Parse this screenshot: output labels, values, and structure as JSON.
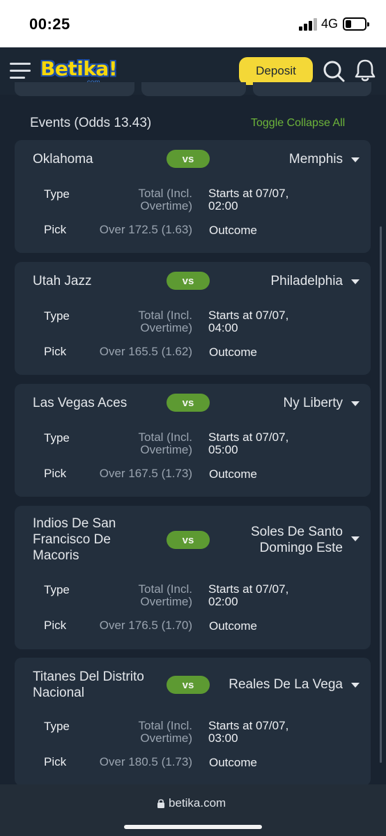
{
  "status_bar": {
    "time": "00:25",
    "network": "4G",
    "battery_percent": 25
  },
  "header": {
    "logo_text": "Betika!",
    "logo_sub": ".com",
    "deposit_label": "Deposit",
    "icons": [
      "menu-icon",
      "search-icon",
      "bell-icon"
    ]
  },
  "events": {
    "title": "Events (Odds 13.43)",
    "toggle_label": "Toggle Collapse All",
    "vs_label": "vs",
    "type_label": "Type",
    "pick_label": "Pick",
    "outcome_label": "Outcome",
    "items": [
      {
        "home": "Oklahoma",
        "away": "Memphis",
        "type_line1": "Total (Incl.",
        "type_line2": "Overtime)",
        "starts_line1": "Starts at 07/07,",
        "starts_line2": "02:00",
        "pick": "Over 172.5 (1.63)"
      },
      {
        "home": "Utah Jazz",
        "away": "Philadelphia",
        "type_line1": "Total (Incl.",
        "type_line2": "Overtime)",
        "starts_line1": "Starts at 07/07,",
        "starts_line2": "04:00",
        "pick": "Over 165.5 (1.62)"
      },
      {
        "home": "Las Vegas Aces",
        "away": "Ny Liberty",
        "type_line1": "Total (Incl.",
        "type_line2": "Overtime)",
        "starts_line1": "Starts at 07/07,",
        "starts_line2": "05:00",
        "pick": "Over 167.5 (1.73)"
      },
      {
        "home_line1": "Indios De San",
        "home_line2": "Francisco De",
        "home_line3": "Macoris",
        "away_line1": "Soles De Santo",
        "away_line2": "Domingo Este",
        "type_line1": "Total (Incl.",
        "type_line2": "Overtime)",
        "starts_line1": "Starts at 07/07,",
        "starts_line2": "02:00",
        "pick": "Over 176.5 (1.70)"
      },
      {
        "home_line1": "Titanes Del Distrito",
        "home_line2": "Nacional",
        "away": "Reales De La Vega",
        "type_line1": "Total (Incl.",
        "type_line2": "Overtime)",
        "starts_line1": "Starts at 07/07,",
        "starts_line2": "03:00",
        "pick": "Over 180.5 (1.73)"
      }
    ]
  },
  "browser": {
    "url": "betika.com"
  },
  "colors": {
    "background": "#192330",
    "card": "#232f3d",
    "accent_green": "#5d9a32",
    "deposit_yellow": "#f4d837"
  }
}
